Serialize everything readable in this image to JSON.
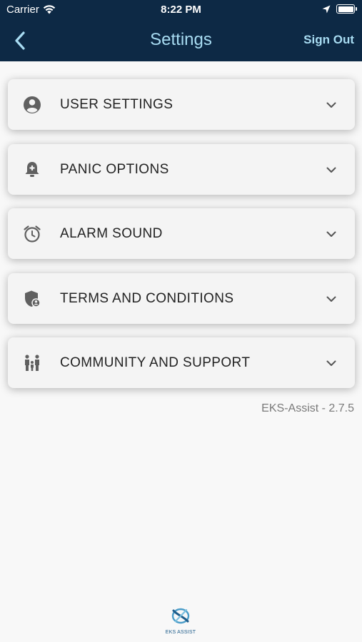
{
  "status": {
    "carrier": "Carrier",
    "time": "8:22 PM"
  },
  "nav": {
    "title": "Settings",
    "sign_out": "Sign Out"
  },
  "items": [
    {
      "label": "USER SETTINGS",
      "icon": "user-circle-icon"
    },
    {
      "label": "PANIC OPTIONS",
      "icon": "bell-plus-icon"
    },
    {
      "label": "ALARM SOUND",
      "icon": "alarm-clock-icon"
    },
    {
      "label": "TERMS AND CONDITIONS",
      "icon": "shield-user-icon"
    },
    {
      "label": "COMMUNITY AND SUPPORT",
      "icon": "family-icon"
    }
  ],
  "version": "EKS-Assist - 2.7.5",
  "logo": {
    "text": "EKS ASSIST"
  },
  "colors": {
    "header": "#0d2945",
    "accent": "#a8dcf2",
    "background": "#f8f8f8"
  }
}
